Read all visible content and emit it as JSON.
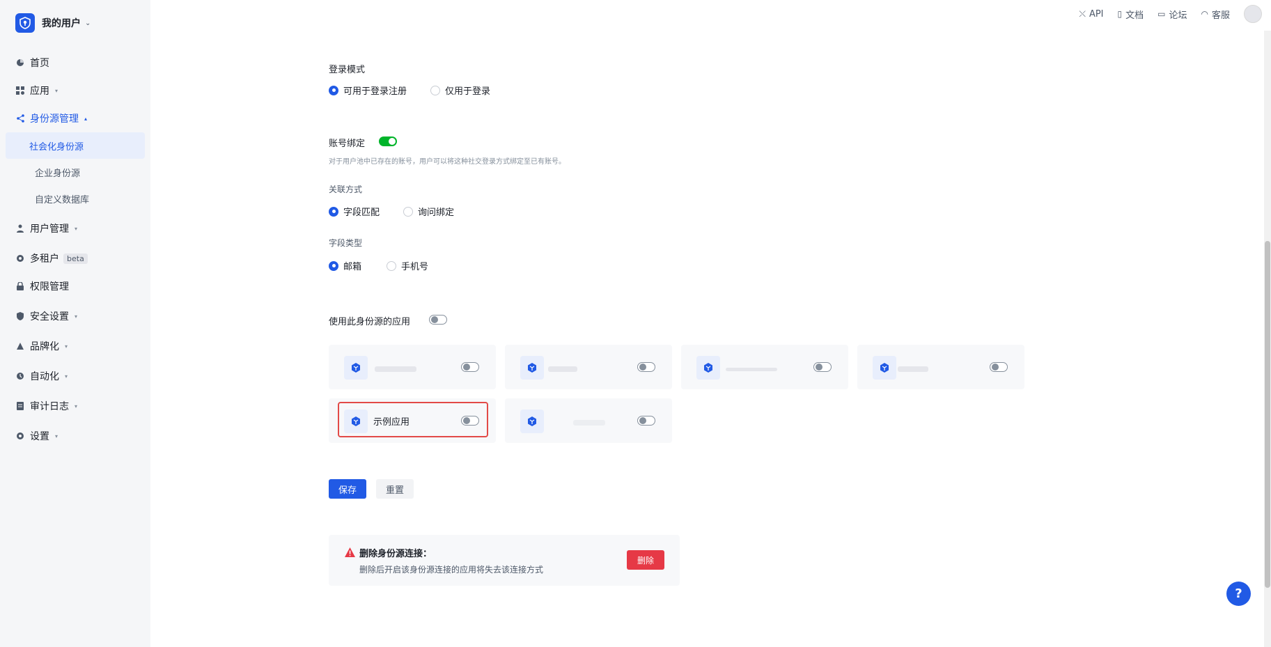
{
  "sidebar": {
    "org_name": "我的用户",
    "items": [
      {
        "label": "首页",
        "icon": "dashboard-icon"
      },
      {
        "label": "应用",
        "icon": "apps-icon"
      },
      {
        "label": "身份源管理",
        "icon": "share-icon"
      },
      {
        "label": "用户管理",
        "icon": "users-icon"
      },
      {
        "label": "多租户",
        "icon": "tenant-icon",
        "badge": "beta"
      },
      {
        "label": "权限管理",
        "icon": "lock-icon"
      },
      {
        "label": "安全设置",
        "icon": "shield-icon"
      },
      {
        "label": "品牌化",
        "icon": "brand-icon"
      },
      {
        "label": "自动化",
        "icon": "automation-icon"
      },
      {
        "label": "审计日志",
        "icon": "log-icon"
      },
      {
        "label": "设置",
        "icon": "settings-icon"
      }
    ],
    "sub_items": [
      {
        "label": "社会化身份源"
      },
      {
        "label": "企业身份源"
      },
      {
        "label": "自定义数据库"
      }
    ]
  },
  "topbar": {
    "api_label": "API",
    "docs_label": "文档",
    "forum_label": "论坛",
    "support_label": "客服"
  },
  "form": {
    "login_mode_label": "登录模式",
    "login_mode_options": [
      "可用于登录注册",
      "仅用于登录"
    ],
    "account_binding_label": "账号绑定",
    "account_binding_hint": "对于用户池中已存在的账号，用户可以将这种社交登录方式绑定至已有账号。",
    "link_method_label": "关联方式",
    "link_method_options": [
      "字段匹配",
      "询问绑定"
    ],
    "field_type_label": "字段类型",
    "field_type_options": [
      "邮箱",
      "手机号"
    ],
    "apps_label": "使用此身份源的应用",
    "apps": [
      {
        "name": ""
      },
      {
        "name": ""
      },
      {
        "name": ""
      },
      {
        "name": ""
      },
      {
        "name": "示例应用"
      },
      {
        "name": ""
      }
    ],
    "save_label": "保存",
    "reset_label": "重置"
  },
  "danger": {
    "title": "删除身份源连接：",
    "desc": "删除后开启该身份源连接的应用将失去该连接方式",
    "button": "删除"
  },
  "help": {
    "label": "?"
  },
  "colors": {
    "primary": "#215ae5",
    "success": "#00b42a",
    "danger": "#e63946",
    "highlight": "#e24a47"
  }
}
